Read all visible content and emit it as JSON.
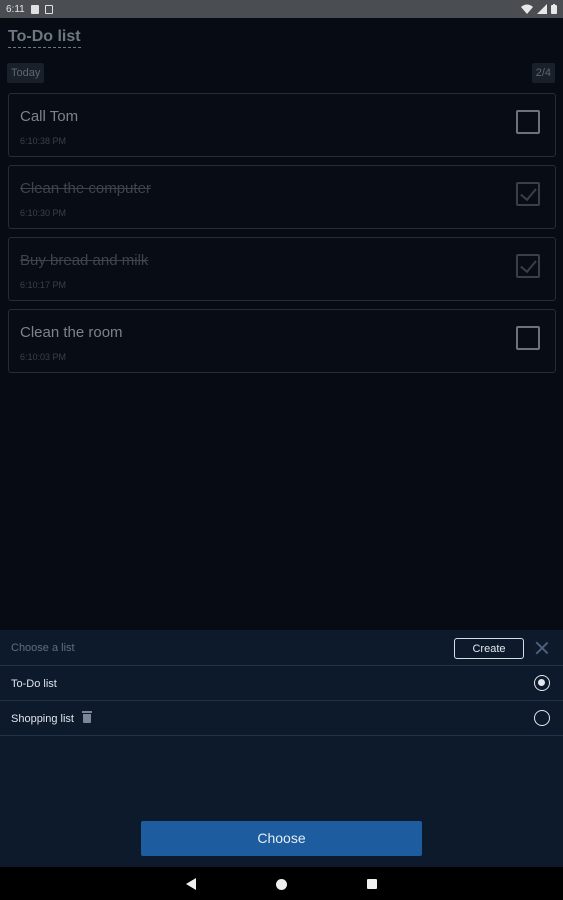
{
  "status_bar": {
    "time": "6:11",
    "icons": [
      "sd-card-icon",
      "shield-icon",
      "wifi-icon",
      "signal-icon",
      "battery-icon"
    ]
  },
  "app": {
    "title": "To-Do list",
    "today_chip": "Today",
    "count_chip": "2/4",
    "tasks": [
      {
        "title": "Call Tom",
        "time": "6:10:38 PM",
        "done": false
      },
      {
        "title": "Clean the computer",
        "time": "6:10:30 PM",
        "done": true
      },
      {
        "title": "Buy bread and milk",
        "time": "6:10:17 PM",
        "done": true
      },
      {
        "title": "Clean the room",
        "time": "6:10:03 PM",
        "done": false
      }
    ]
  },
  "sheet": {
    "label": "Choose a list",
    "create_label": "Create",
    "options": [
      {
        "label": "To-Do list",
        "selected": true,
        "deletable": false
      },
      {
        "label": "Shopping list",
        "selected": false,
        "deletable": true
      }
    ],
    "choose_label": "Choose"
  },
  "colors": {
    "accent": "#1d5c9e",
    "sheet_background": "#0c1a2c",
    "app_background": "#060b14"
  }
}
